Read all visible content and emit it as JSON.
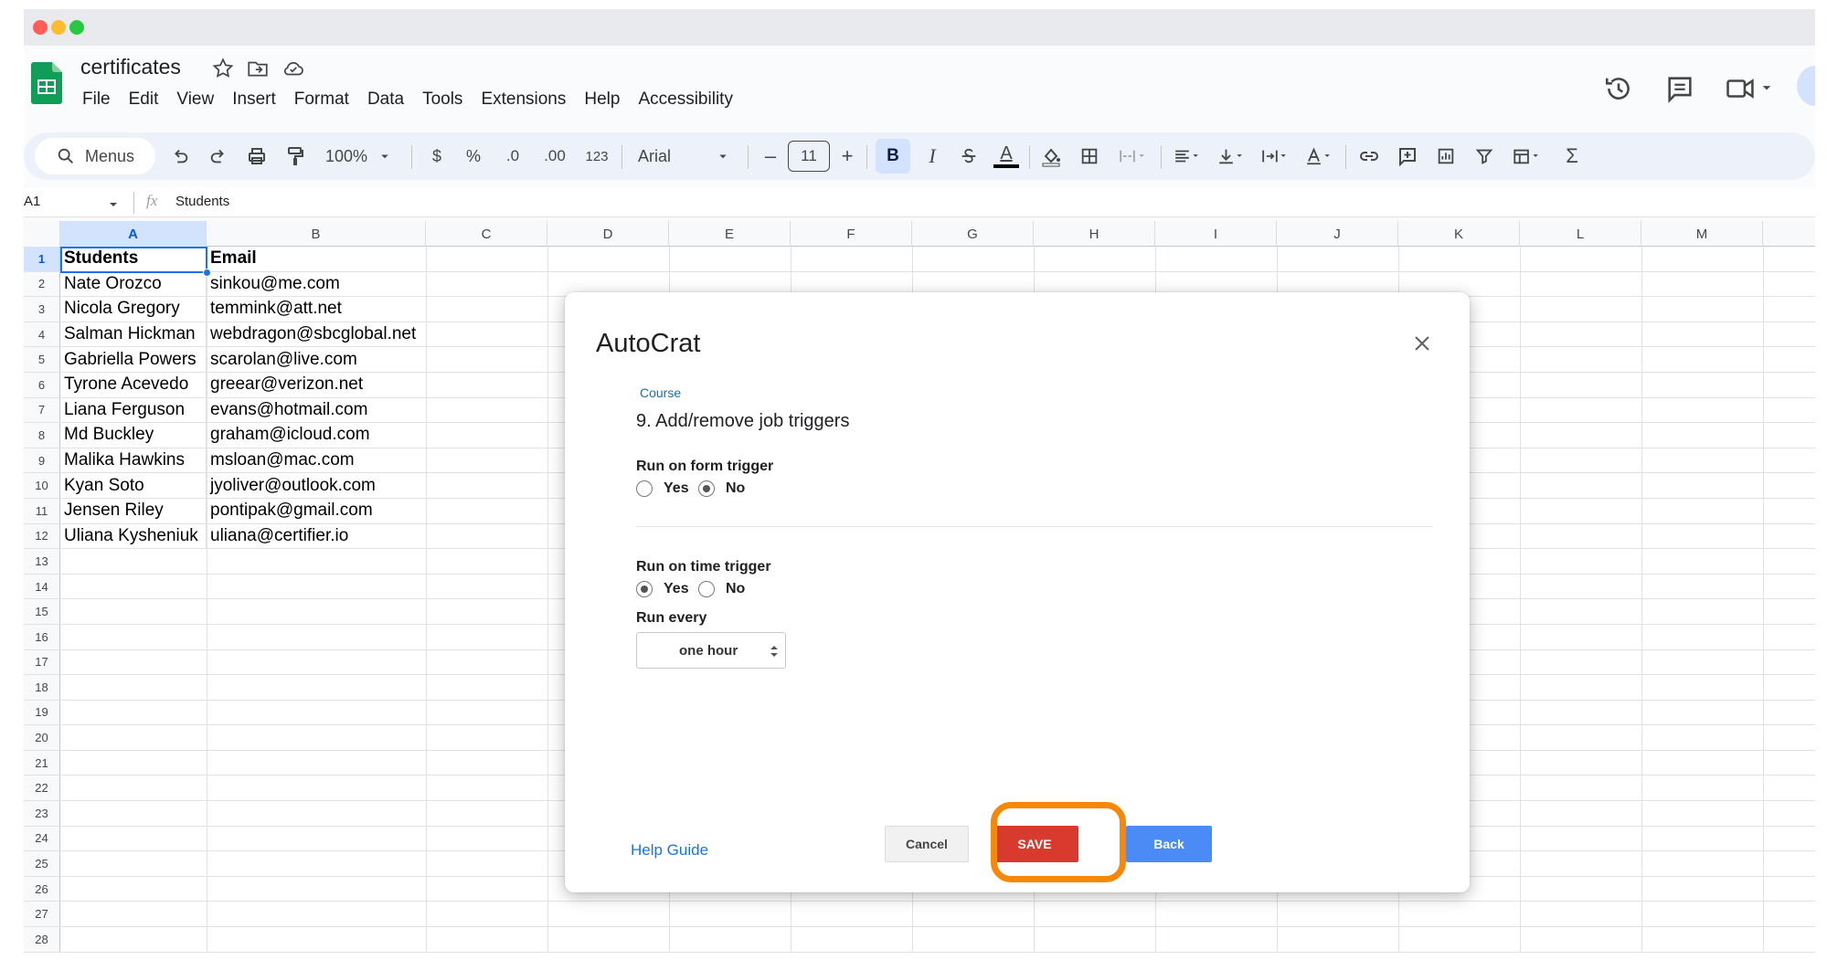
{
  "document": {
    "title": "certificates",
    "menu": [
      "File",
      "Edit",
      "View",
      "Insert",
      "Format",
      "Data",
      "Tools",
      "Extensions",
      "Help",
      "Accessibility"
    ]
  },
  "toolbar": {
    "menus_label": "Menus",
    "zoom": "100%",
    "currency": "$",
    "percent": "%",
    "decrease_decimal": ".0",
    "increase_decimal": ".00",
    "number_format": "123",
    "font": "Arial",
    "minus": "–",
    "font_size": "11",
    "plus": "+",
    "bold": "B",
    "italic": "I",
    "text_color": "A",
    "sum": "Σ"
  },
  "formula_bar": {
    "cell_ref": "A1",
    "fx": "fx",
    "value": "Students"
  },
  "sheet": {
    "columns": [
      "A",
      "B",
      "C",
      "D",
      "E",
      "F",
      "G",
      "H",
      "I",
      "J",
      "K",
      "L",
      "M"
    ],
    "row_numbers": [
      "1",
      "2",
      "3",
      "4",
      "5",
      "6",
      "7",
      "8",
      "9",
      "10",
      "11",
      "12",
      "13",
      "14",
      "15",
      "16",
      "17",
      "18",
      "19",
      "20",
      "21",
      "22",
      "23",
      "24",
      "25",
      "26",
      "27",
      "28"
    ],
    "rows": [
      [
        "Students",
        "Email"
      ],
      [
        "Nate Orozco",
        "sinkou@me.com"
      ],
      [
        "Nicola Gregory",
        "temmink@att.net"
      ],
      [
        "Salman Hickman",
        "webdragon@sbcglobal.net"
      ],
      [
        "Gabriella Powers",
        "scarolan@live.com"
      ],
      [
        "Tyrone Acevedo",
        "greear@verizon.net"
      ],
      [
        "Liana Ferguson",
        "evans@hotmail.com"
      ],
      [
        "Md Buckley",
        "graham@icloud.com"
      ],
      [
        "Malika Hawkins",
        "msloan@mac.com"
      ],
      [
        "Kyan Soto",
        "jyoliver@outlook.com"
      ],
      [
        "Jensen Riley",
        "pontipak@gmail.com"
      ],
      [
        "Uliana Kysheniuk",
        "uliana@certifier.io"
      ]
    ]
  },
  "dialog": {
    "title": "AutoCrat",
    "course": "Course",
    "step": "9. Add/remove job triggers",
    "form_trigger": {
      "label": "Run on form trigger",
      "yes": "Yes",
      "no": "No",
      "selected": "No"
    },
    "time_trigger": {
      "label": "Run on time trigger",
      "yes": "Yes",
      "no": "No",
      "selected": "Yes"
    },
    "run_every": {
      "label": "Run every",
      "value": "one hour"
    },
    "help_guide": "Help Guide",
    "cancel": "Cancel",
    "save": "SAVE",
    "back": "Back"
  },
  "colors": {
    "save_button": "#d93a2e",
    "back_button": "#4b8bf5",
    "highlight": "#f5880a"
  }
}
